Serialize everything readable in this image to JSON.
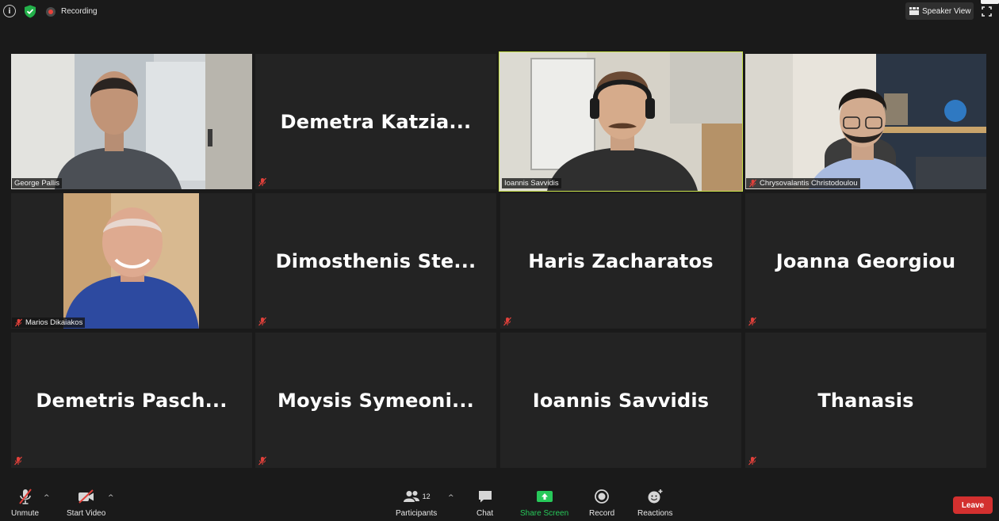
{
  "topbar": {
    "info_icon": "info-icon",
    "security_icon": "shield-check-icon",
    "recording_label": "Recording",
    "speaker_view_label": "Speaker View",
    "fullscreen_icon": "fullscreen-icon"
  },
  "tiles": [
    {
      "name": "George Pallis",
      "video": true,
      "muted": false
    },
    {
      "name": "Demetra  Katzia...",
      "video": false,
      "muted": true
    },
    {
      "name": "Ioannis Savvidis",
      "video": true,
      "muted": false,
      "active_speaker": true
    },
    {
      "name": "Chrysovalantis Christodoulou",
      "video": true,
      "muted": true
    },
    {
      "name": "Marios Dikaiakos",
      "video": true,
      "muted": true
    },
    {
      "name": "Dimosthenis  Ste...",
      "video": false,
      "muted": true
    },
    {
      "name": "Haris Zacharatos",
      "video": false,
      "muted": true
    },
    {
      "name": "Joanna Georgiou",
      "video": false,
      "muted": true
    },
    {
      "name": "Demetris  Pasch...",
      "video": false,
      "muted": true
    },
    {
      "name": "Moysis  Symeoni...",
      "video": false,
      "muted": true
    },
    {
      "name": "Ioannis Savvidis",
      "video": false,
      "muted": false
    },
    {
      "name": "Thanasis",
      "video": false,
      "muted": true
    }
  ],
  "toolbar": {
    "unmute_label": "Unmute",
    "start_video_label": "Start Video",
    "participants_label": "Participants",
    "participants_count": "12",
    "chat_label": "Chat",
    "share_screen_label": "Share Screen",
    "record_label": "Record",
    "reactions_label": "Reactions",
    "leave_label": "Leave"
  },
  "colors": {
    "background": "#1a1a1a",
    "tile": "#232323",
    "active_speaker_border": "#c9e24a",
    "share_green": "#27c95a",
    "leave_red": "#d3302f",
    "mute_red": "#e0403a"
  }
}
